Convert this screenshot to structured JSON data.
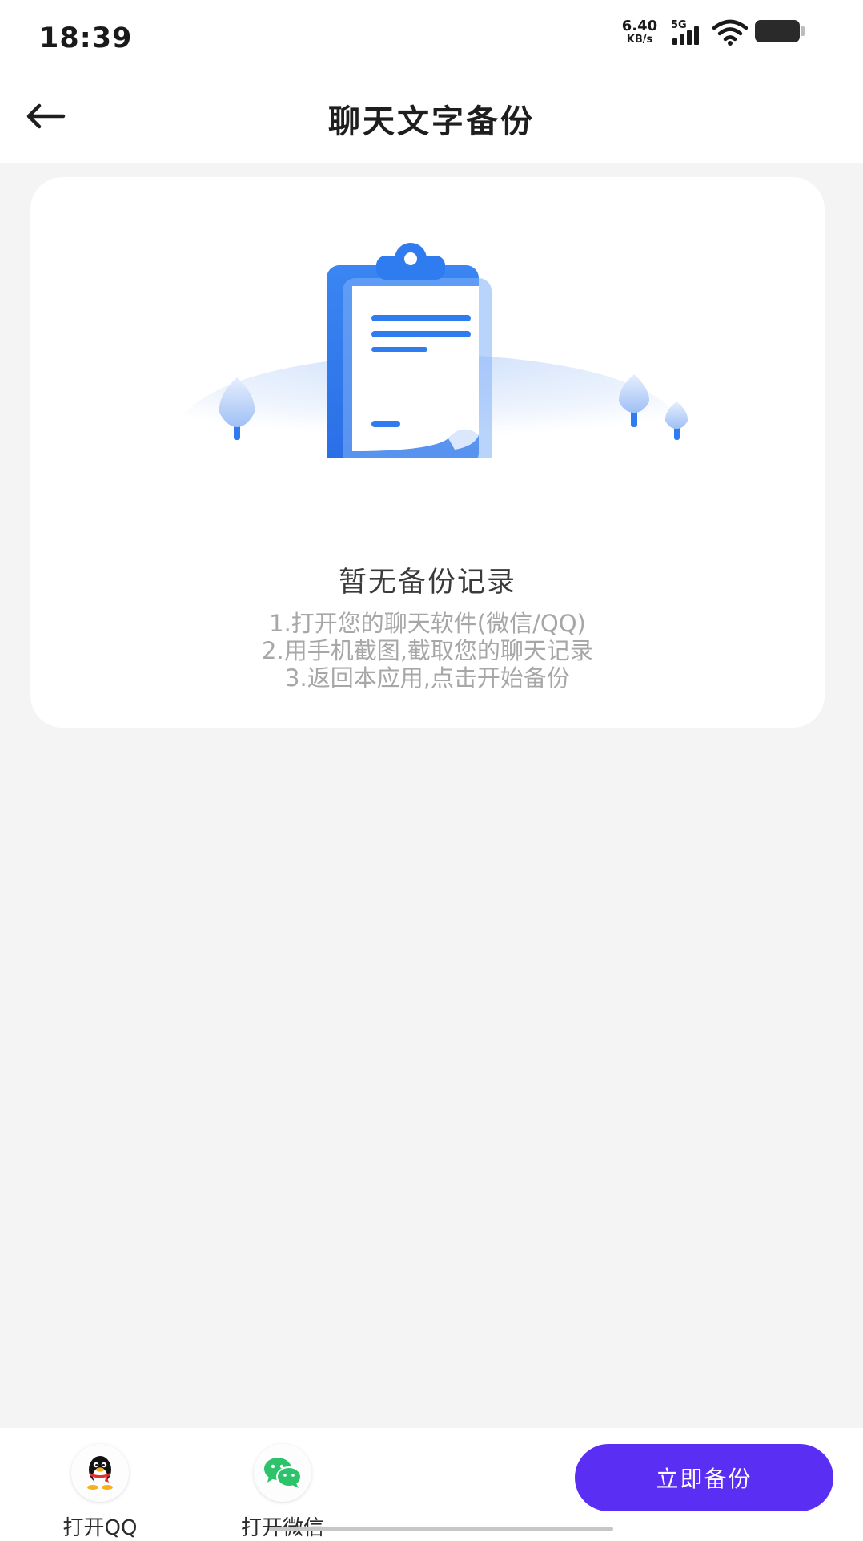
{
  "status_bar": {
    "time": "18:39",
    "net_speed_value": "6.40",
    "net_speed_unit": "KB/s",
    "network_type": "5G"
  },
  "header": {
    "title": "聊天文字备份",
    "back_icon": "arrow-left-icon"
  },
  "empty_state": {
    "title": "暂无备份记录",
    "illustration_icon": "clipboard-icon",
    "steps": [
      "1.打开您的聊天软件(微信/QQ)",
      "2.用手机截图,截取您的聊天记录",
      "3.返回本应用,点击开始备份"
    ]
  },
  "bottom_bar": {
    "open_qq_label": "打开QQ",
    "open_wechat_label": "打开微信",
    "backup_button_label": "立即备份"
  },
  "colors": {
    "accent": "#5a2ef3",
    "illustration_blue": "#2f7bf0",
    "background": "#f4f4f4",
    "wechat_green": "#2dc36a"
  }
}
